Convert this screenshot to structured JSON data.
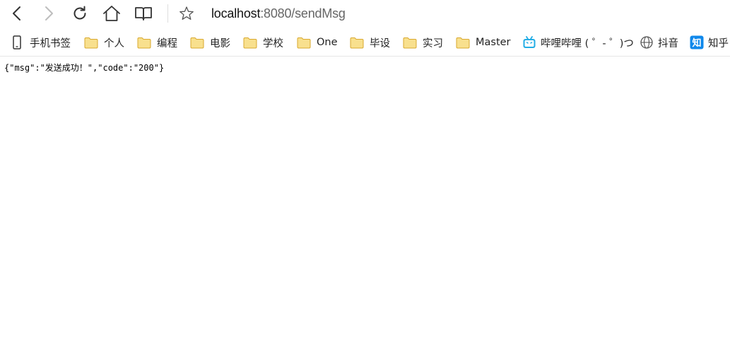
{
  "browser": {
    "nav": {
      "back_icon": "chevron-left-icon",
      "forward_icon": "chevron-right-icon",
      "refresh_icon": "refresh-icon",
      "home_icon": "home-icon",
      "reading_view_icon": "book-icon",
      "favorite_icon": "star-icon"
    },
    "address": {
      "host": "localhost",
      "rest": ":8080/sendMsg"
    },
    "bookmarks": [
      {
        "icon": "phone-icon",
        "label": "手机书签"
      },
      {
        "icon": "folder-icon",
        "label": "个人"
      },
      {
        "icon": "folder-icon",
        "label": "编程"
      },
      {
        "icon": "folder-icon",
        "label": "电影"
      },
      {
        "icon": "folder-icon",
        "label": "学校"
      },
      {
        "icon": "folder-icon",
        "label": "One"
      },
      {
        "icon": "folder-icon",
        "label": "毕设"
      },
      {
        "icon": "folder-icon",
        "label": "实习"
      },
      {
        "icon": "folder-icon",
        "label": "Master"
      },
      {
        "icon": "bilibili-icon",
        "label": "哔哩哔哩 ( ゜- ゜)つ"
      },
      {
        "icon": "globe-icon",
        "label": "抖音"
      },
      {
        "icon": "zhihu-icon",
        "label": "知乎"
      }
    ]
  },
  "page": {
    "response_text": "{\"msg\":\"发送成功！\",\"code\":\"200\"}"
  },
  "colors": {
    "folder": "#f6d77a",
    "bilibili": "#23ade5",
    "zhihu": "#0f88eb",
    "icon_stroke": "#333333",
    "disabled_icon": "#bdbdbd"
  }
}
